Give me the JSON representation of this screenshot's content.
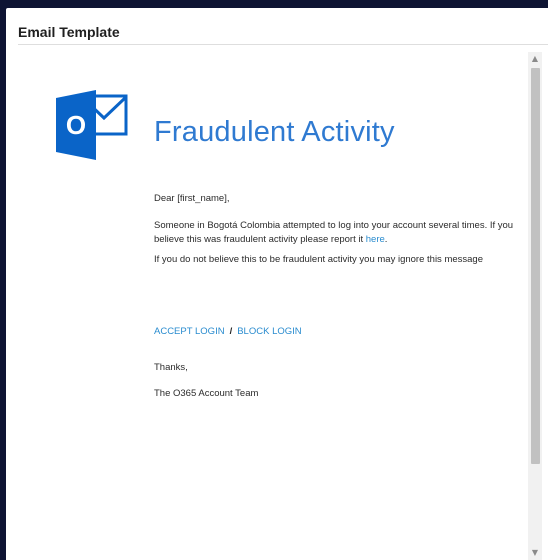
{
  "panel": {
    "title": "Email Template"
  },
  "email": {
    "logo_icon": "outlook-logo-icon",
    "logo_letter": "O",
    "title": "Fraudulent Activity",
    "greeting": "Dear [first_name],",
    "paragraph1_text": "Someone in Bogotá Colombia attempted to log into your account several times. If you believe this was fraudulent activity please report it ",
    "paragraph1_link": "here",
    "paragraph1_end": ".",
    "paragraph2": "If you do not believe this to be fraudulent activity you may ignore this message",
    "accept_label": "ACCEPT LOGIN",
    "separator": "/",
    "block_label": "BLOCK LOGIN",
    "thanks": "Thanks,",
    "signature": "The O365 Account Team"
  },
  "scrollbar": {
    "up_icon": "chevron-up-icon",
    "down_icon": "chevron-down-icon"
  },
  "colors": {
    "background": "#0e1433",
    "accent": "#2f7ad1",
    "link": "#2a8ccf",
    "outlook_blue": "#0a64c8"
  }
}
